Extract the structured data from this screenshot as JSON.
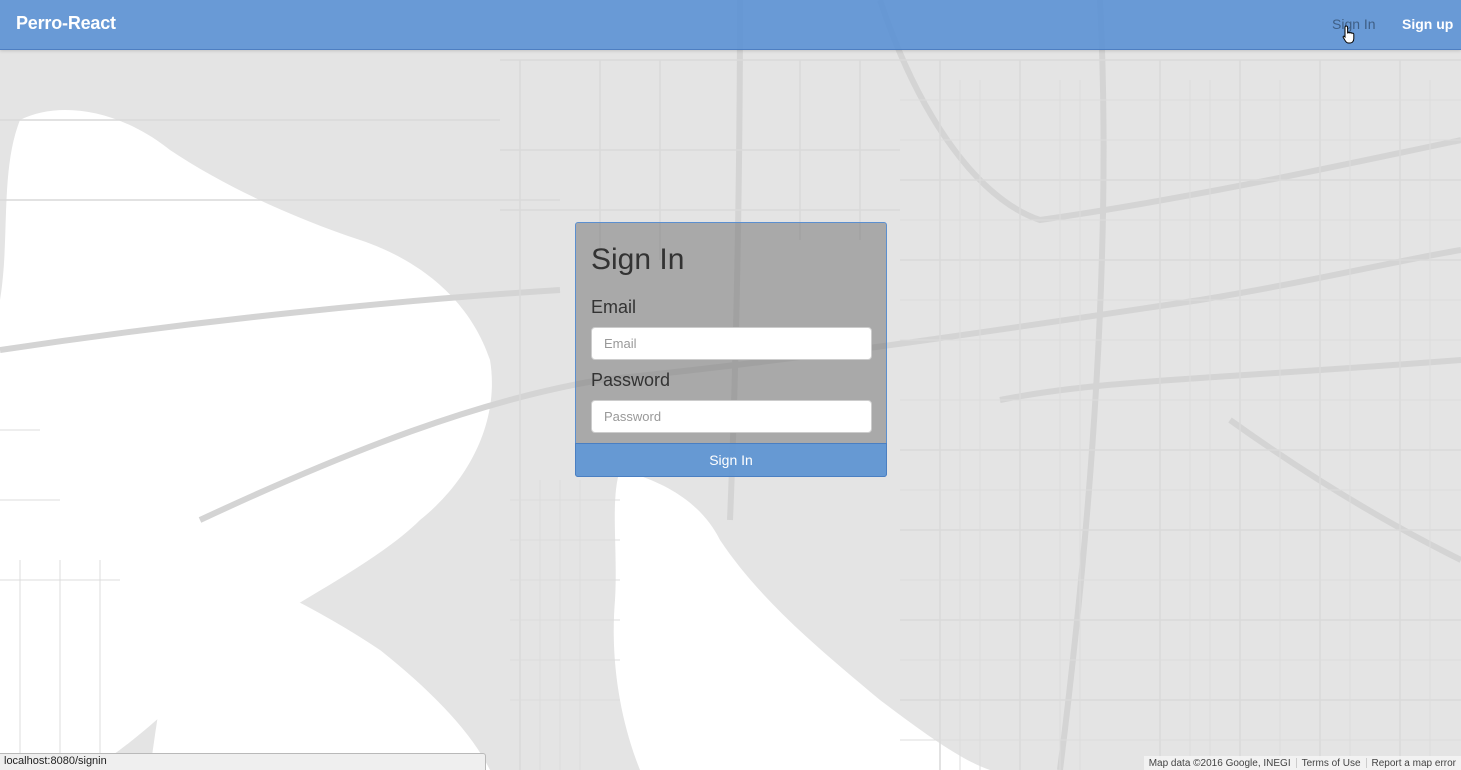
{
  "navbar": {
    "brand": "Perro-React",
    "links": {
      "signin": "Sign In",
      "signup": "Sign up"
    }
  },
  "form": {
    "title": "Sign In",
    "email_label": "Email",
    "email_placeholder": "Email",
    "password_label": "Password",
    "password_placeholder": "Password",
    "submit_label": "Sign In"
  },
  "status_bar": {
    "url": "localhost:8080/signin"
  },
  "map_footer": {
    "attribution": "Map data ©2016 Google, INEGI",
    "terms": "Terms of Use",
    "report": "Report a map error"
  },
  "colors": {
    "navbar": "#5890d4",
    "accent": "#6298d5",
    "map_land": "#e5e5e5",
    "map_water": "#ffffff"
  }
}
